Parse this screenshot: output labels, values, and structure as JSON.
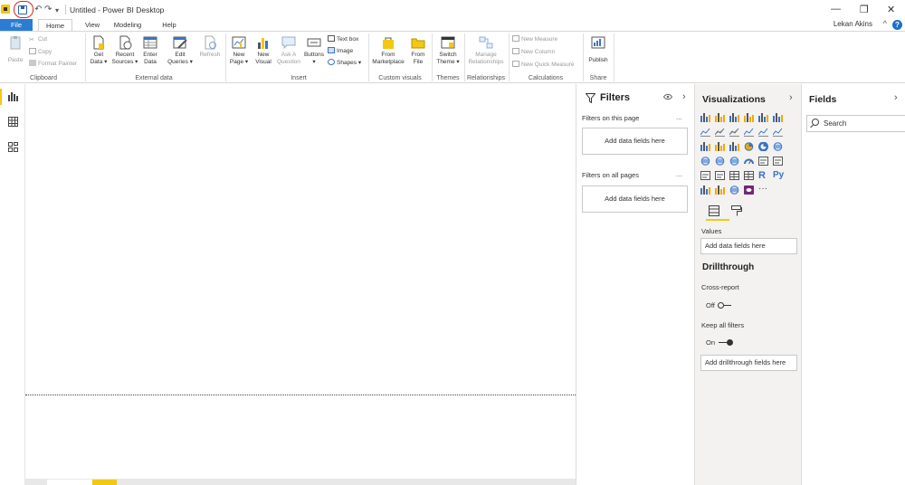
{
  "window": {
    "title": "Untitled - Power BI Desktop",
    "user": "Lekan Akins",
    "minimize": "—",
    "restore": "❐",
    "close": "✕",
    "undo": "↶",
    "redo": "↷",
    "qat_more": "▾"
  },
  "tabs": {
    "file": "File",
    "items": [
      "Home",
      "View",
      "Modeling",
      "Help"
    ],
    "active": "Home"
  },
  "ribbon": {
    "clipboard": {
      "label": "Clipboard",
      "paste": "Paste",
      "cut": "Cut",
      "copy": "Copy",
      "format_painter": "Format Painter"
    },
    "external_data": {
      "label": "External data",
      "get_data": [
        "Get",
        "Data ▾"
      ],
      "recent_sources": [
        "Recent",
        "Sources ▾"
      ],
      "enter_data": [
        "Enter",
        "Data"
      ],
      "edit_queries": [
        "Edit",
        "Queries ▾"
      ],
      "refresh": "Refresh"
    },
    "insert": {
      "label": "Insert",
      "new_page": [
        "New",
        "Page ▾"
      ],
      "new_visual": [
        "New",
        "Visual"
      ],
      "ask_question": [
        "Ask A",
        "Question"
      ],
      "buttons": "Buttons ▾",
      "text_box": "Text box",
      "image": "Image",
      "shapes": "Shapes ▾"
    },
    "custom_visuals": {
      "label": "Custom visuals",
      "from_marketplace": [
        "From",
        "Marketplace"
      ],
      "from_file": [
        "From",
        "File"
      ]
    },
    "themes": {
      "label": "Themes",
      "switch_theme": [
        "Switch",
        "Theme ▾"
      ]
    },
    "relationships": {
      "label": "Relationships",
      "manage": [
        "Manage",
        "Relationships"
      ]
    },
    "calculations": {
      "label": "Calculations",
      "new_measure": "New Measure",
      "new_column": "New Column",
      "new_quick_measure": "New Quick Measure"
    },
    "share": {
      "label": "Share",
      "publish": "Publish"
    }
  },
  "filters": {
    "title": "Filters",
    "on_this_page": "Filters on this page",
    "on_all_pages": "Filters on all pages",
    "add_fields": "Add data fields here",
    "more": "...",
    "collapse": "›"
  },
  "visualizations": {
    "title": "Visualizations",
    "collapse": "›",
    "values_label": "Values",
    "values_placeholder": "Add data fields here",
    "drillthrough": "Drillthrough",
    "cross_report": "Cross-report",
    "cross_report_state": "Off",
    "keep_all_filters": "Keep all filters",
    "keep_all_filters_state": "On",
    "drill_placeholder": "Add drillthrough fields here",
    "more_visuals": "···",
    "r_visual": "R",
    "py_visual": "Py"
  },
  "fields": {
    "title": "Fields",
    "collapse": "›",
    "search_placeholder": "Search"
  },
  "colors": {
    "accent_yellow": "#f2c811",
    "file_tab_blue": "#2b7cd3",
    "highlight_red": "#e02020",
    "viz_pane_bg": "#f3f2f1"
  }
}
